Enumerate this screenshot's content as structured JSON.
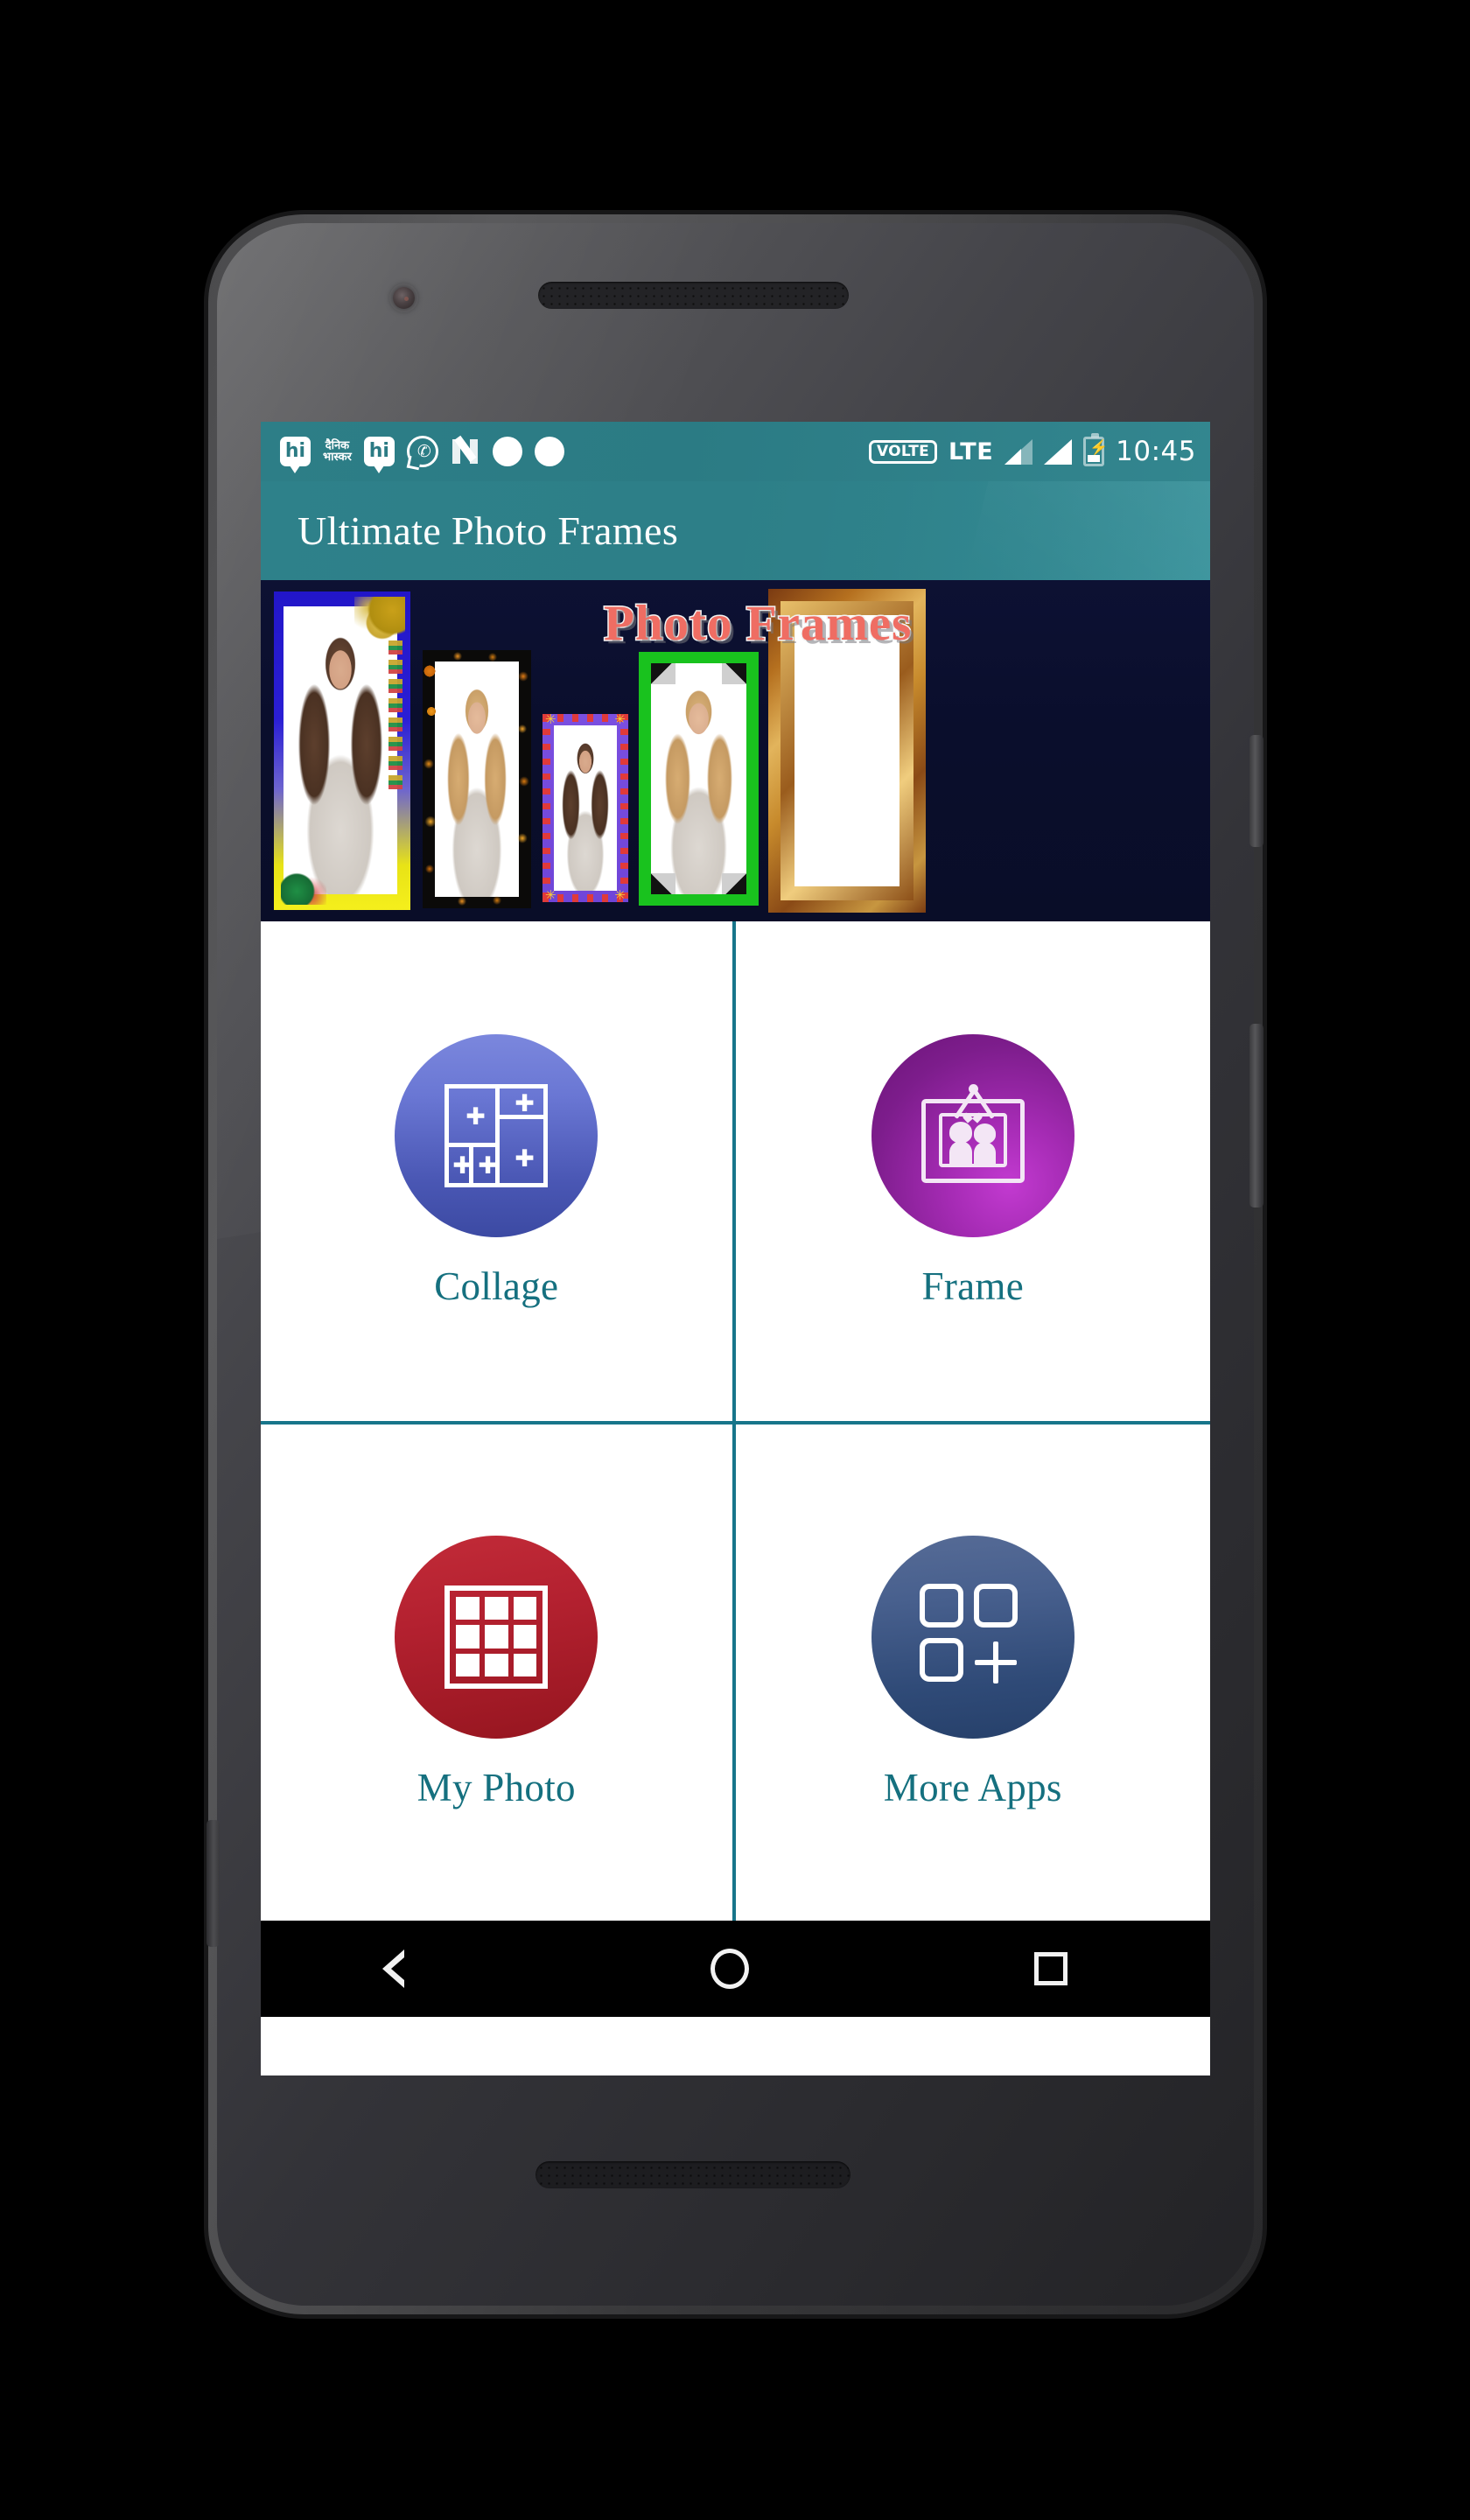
{
  "device": {
    "camera": "front-camera",
    "earpiece": "earpiece-speaker-grille",
    "bottom_speaker": "bottom-speaker-grille"
  },
  "status_bar": {
    "notification_icons": [
      {
        "name": "hike-messenger-icon",
        "glyph": "hi"
      },
      {
        "name": "dainik-bhaskar-icon",
        "line1": "दैनिक",
        "line2": "भास्कर"
      },
      {
        "name": "hike-messenger-icon-2",
        "glyph": "hi"
      },
      {
        "name": "whatsapp-icon",
        "glyph": "✆"
      },
      {
        "name": "android-nougat-icon",
        "glyph": "N"
      },
      {
        "name": "notification-dot-icon",
        "glyph": ""
      },
      {
        "name": "notification-dot-icon-2",
        "glyph": ""
      }
    ],
    "volte_label": "VOLTE",
    "network_label": "LTE",
    "signal_1": "signal-bars-partial",
    "signal_2": "signal-bars-full",
    "battery": "battery-charging-icon",
    "battery_glyph": "⚡",
    "time": "10:45"
  },
  "app_bar": {
    "title": "Ultimate Photo Frames"
  },
  "banner": {
    "title": "Photo Frames",
    "frames": [
      {
        "name": "banner-frame-blue-floral",
        "style": "blue-yellow-gradient-floral"
      },
      {
        "name": "banner-frame-black-autumn",
        "style": "black-autumn-leaves"
      },
      {
        "name": "banner-frame-purple-stars",
        "style": "purple-red-stars"
      },
      {
        "name": "banner-frame-green-pearls",
        "style": "green-pearl-border"
      },
      {
        "name": "banner-frame-gold-ornate",
        "style": "ornate-gold-wood"
      }
    ]
  },
  "menu": {
    "items": [
      {
        "id": "collage",
        "label": "Collage",
        "icon": "collage-grid-icon",
        "color": "#4a57b4"
      },
      {
        "id": "frame",
        "label": "Frame",
        "icon": "picture-frame-icon",
        "color": "#a52bb4"
      },
      {
        "id": "my-photo",
        "label": "My Photo",
        "icon": "photo-grid-icon",
        "color": "#b42130"
      },
      {
        "id": "more-apps",
        "label": "More Apps",
        "icon": "apps-plus-icon",
        "color": "#2f4a77"
      }
    ],
    "divider_color": "#17758a",
    "label_color": "#15707f"
  },
  "nav_bar": {
    "back": "back-triangle-icon",
    "home": "home-circle-icon",
    "recents": "recents-square-icon"
  },
  "theme": {
    "primary": "#2d7f88",
    "accent": "#17758a",
    "banner_bg": "#0a0e2c",
    "banner_title_color": "#ef6d63"
  }
}
